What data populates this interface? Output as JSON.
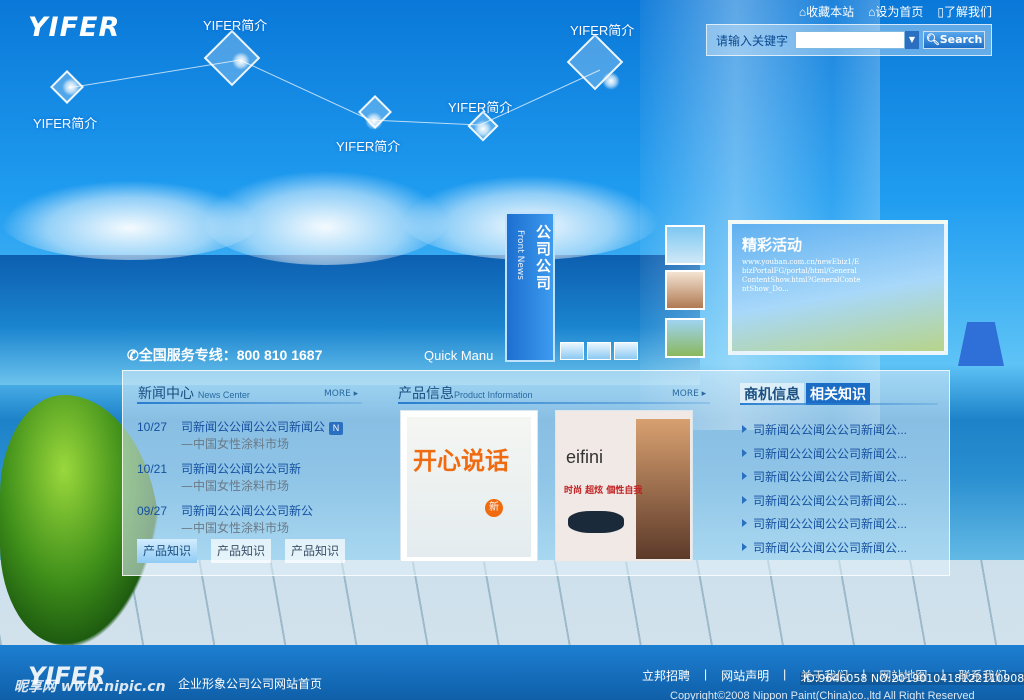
{
  "brand": {
    "logo": "YIFER"
  },
  "kites": [
    "YIFER简介",
    "YIFER简介",
    "YIFER简介",
    "YIFER简介",
    "YIFER简介"
  ],
  "top_links": [
    "收藏本站",
    "设为首页",
    "了解我们"
  ],
  "search": {
    "label": "请输入关键字",
    "value": "",
    "button": "Search"
  },
  "hotline": {
    "text": "全国服务专线：800 810 1687"
  },
  "quick_menu": {
    "label": "Quick Manu"
  },
  "front_news": {
    "cn": "公司公司",
    "en": "Front News"
  },
  "activity": {
    "title": "精彩活动",
    "url": "www.youban.com.cn/newEbiz1/EbizPortalFG/portal/html/GeneralContentShow.html?GeneralContentShow_Do..."
  },
  "news": {
    "title": "新闻中心",
    "subtitle": "News Center",
    "more": "MORE",
    "items": [
      {
        "date": "10/27",
        "title": "司新闻公公闻公公司新闻公",
        "tag": "N",
        "sub": "—中国女性涂料市场"
      },
      {
        "date": "10/21",
        "title": "司新闻公公闻公公司新",
        "tag": "",
        "sub": "—中国女性涂料市场"
      },
      {
        "date": "09/27",
        "title": "司新闻公公闻公公司新公",
        "tag": "",
        "sub": "—中国女性涂料市场"
      }
    ],
    "tabs": [
      "产品知识",
      "产品知识",
      "产品知识"
    ]
  },
  "products": {
    "title": "产品信息",
    "subtitle": "Product Information",
    "more": "MORE",
    "items": [
      {
        "headline": "开心说话",
        "badge": "新"
      },
      {
        "headline": "eifini",
        "tag1": "时尚",
        "tag2": "超炫",
        "tag3": "個性自我"
      }
    ]
  },
  "business": {
    "tabs": [
      "商机信息",
      "相关知识"
    ],
    "items": [
      "司新闻公公闻公公司新闻公...",
      "司新闻公公闻公公司新闻公...",
      "司新闻公公闻公公司新闻公...",
      "司新闻公公闻公公司新闻公...",
      "司新闻公公闻公公司新闻公...",
      "司新闻公公闻公公司新闻公..."
    ]
  },
  "footer": {
    "logo": "YIFER",
    "text": "企业形象公司公司网站首页",
    "links": [
      "立邦招聘",
      "网站声明",
      "关于我们",
      "网站地图",
      "联系我们"
    ],
    "copyright": "Copyright©2008 Nippon Paint(China)co.,ltd All Right Reserved",
    "watermark_left": "昵享网 www.nipic.cn",
    "watermark_right": "ID:9646058 NO:20190104181221109081"
  },
  "colors": {
    "accent": "#1b6cc4",
    "link": "#1550a0",
    "sky": "#1f9cf0"
  }
}
